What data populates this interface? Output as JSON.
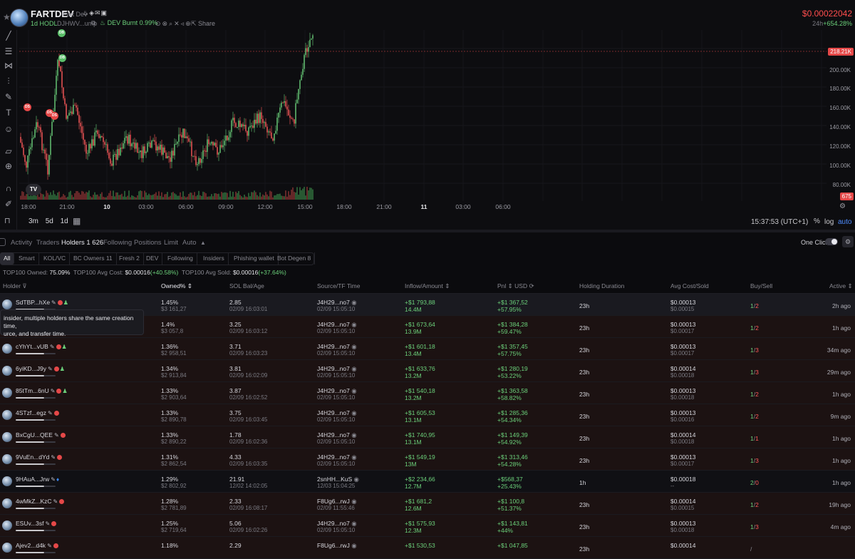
{
  "header": {
    "token_name": "FARTDEV",
    "token_sub": "Fart Dev",
    "hodl": "1d HODL",
    "address": "DJHWV...ump",
    "dev_burnt": "DEV Burnt 0.99%",
    "share": "Share",
    "price": "$0.00022042",
    "change_label": "24h",
    "change_value": "+654.28%"
  },
  "chart": {
    "y_ticks": [
      "200.00K",
      "180.00K",
      "160.00K",
      "140.00K",
      "120.00K",
      "100.00K",
      "80.00K"
    ],
    "current_label": "218.21K",
    "volume_label": "675",
    "x_ticks": [
      "18:00",
      "21:00",
      "10",
      "03:00",
      "06:00",
      "09:00",
      "12:00",
      "15:00",
      "18:00",
      "21:00",
      "11",
      "03:00",
      "06:00"
    ],
    "markers": [
      "DS",
      "DS",
      "DS",
      "DB",
      "DB"
    ],
    "timeframes": [
      "3m",
      "5d",
      "1d"
    ],
    "time_utc": "15:37:53 (UTC+1)",
    "pct": "%",
    "log": "log",
    "auto": "auto",
    "tv_logo": "TV"
  },
  "tabs": {
    "items": [
      "Activity",
      "Traders",
      "Holders 1 626",
      "Following",
      "Positions",
      "Limit",
      "Auto"
    ],
    "active": "Holders 1 626",
    "one_click": "One Click"
  },
  "filters": [
    "All",
    "Smart",
    "KOL/VC",
    "BC Owners 11",
    "Fresh 2",
    "DEV",
    "Following",
    "Insiders",
    "Phishing wallet",
    "Bot Degen 8"
  ],
  "summary": {
    "owned_label": "TOP100 Owned:",
    "owned_value": "75.09%",
    "avg_cost_label": "TOP100 Avg Cost:",
    "avg_cost_value": "$0.00016",
    "avg_cost_change": "(+40.58%)",
    "avg_sold_label": "TOP100 Avg Sold:",
    "avg_sold_value": "$0.00016",
    "avg_sold_change": "(+37.64%)"
  },
  "columns": [
    "Holder",
    "Owned%",
    "SOL Bal/Age",
    "Source/TF Time",
    "Inflow/Amount",
    "Pnl",
    "USD",
    "Holding Duration",
    "Avg Cost/Sold",
    "Buy/Sell",
    "Active"
  ],
  "tooltip": {
    "line1": "insider, multiple holders share the same creation time,",
    "line2": "urce, and transfer time."
  },
  "rows": [
    {
      "holder": "SdTBP...hXe",
      "owned": "1.45%",
      "owned_usd": "$3 161,27",
      "sol": "2.85",
      "age": "02/09 16:03:01",
      "src": "J4H29...no7",
      "tf": "02/09 15:05:10",
      "inflow": "+$1 793,88",
      "amount": "14.4M",
      "pnl": "+$1 367,52",
      "pnl_pct": "+57.95%",
      "dur": "23h",
      "avg_cost": "$0.00013",
      "avg_sold": "$0.00015",
      "buy": "1",
      "sell": "2",
      "active": "2h ago"
    },
    {
      "holder": "",
      "owned": "1.4%",
      "owned_usd": "$3 057,8",
      "sol": "3.25",
      "age": "02/09 16:03:12",
      "src": "J4H29...no7",
      "tf": "02/09 15:05:10",
      "inflow": "+$1 673,64",
      "amount": "13.9M",
      "pnl": "+$1 384,28",
      "pnl_pct": "+59.47%",
      "dur": "23h",
      "avg_cost": "$0.00013",
      "avg_sold": "$0.00017",
      "buy": "1",
      "sell": "2",
      "active": "1h ago"
    },
    {
      "holder": "cYhYt...vUB",
      "owned": "1.36%",
      "owned_usd": "$2 958,51",
      "sol": "3.71",
      "age": "02/09 16:03:23",
      "src": "J4H29...no7",
      "tf": "02/09 15:05:10",
      "inflow": "+$1 601,18",
      "amount": "13.4M",
      "pnl": "+$1 357,45",
      "pnl_pct": "+57.75%",
      "dur": "23h",
      "avg_cost": "$0.00013",
      "avg_sold": "$0.00017",
      "buy": "1",
      "sell": "3",
      "active": "34m ago"
    },
    {
      "holder": "6yiKD...J9y",
      "owned": "1.34%",
      "owned_usd": "$2 913,84",
      "sol": "3.81",
      "age": "02/09 16:02:09",
      "src": "J4H29...no7",
      "tf": "02/09 15:05:10",
      "inflow": "+$1 633,76",
      "amount": "13.2M",
      "pnl": "+$1 280,19",
      "pnl_pct": "+53.22%",
      "dur": "23h",
      "avg_cost": "$0.00014",
      "avg_sold": "$0.00018",
      "buy": "1",
      "sell": "3",
      "active": "29m ago"
    },
    {
      "holder": "85tTm...6nU",
      "owned": "1.33%",
      "owned_usd": "$2 903,64",
      "sol": "3.87",
      "age": "02/09 16:02:52",
      "src": "J4H29...no7",
      "tf": "02/09 15:05:10",
      "inflow": "+$1 540,18",
      "amount": "13.2M",
      "pnl": "+$1 363,58",
      "pnl_pct": "+58.82%",
      "dur": "23h",
      "avg_cost": "$0.00013",
      "avg_sold": "$0.00018",
      "buy": "1",
      "sell": "2",
      "active": "1h ago"
    },
    {
      "holder": "4STzf...egz",
      "owned": "1.33%",
      "owned_usd": "$2 890,78",
      "sol": "3.75",
      "age": "02/09 16:03:45",
      "src": "J4H29...no7",
      "tf": "02/09 15:05:10",
      "inflow": "+$1 605,53",
      "amount": "13.1M",
      "pnl": "+$1 285,36",
      "pnl_pct": "+54.34%",
      "dur": "23h",
      "avg_cost": "$0.00013",
      "avg_sold": "$0.00016",
      "buy": "1",
      "sell": "2",
      "active": "9m ago"
    },
    {
      "holder": "BxCgU...QEE",
      "owned": "1.33%",
      "owned_usd": "$2 890,22",
      "sol": "1.78",
      "age": "02/09 16:02:36",
      "src": "J4H29...no7",
      "tf": "02/09 15:05:10",
      "inflow": "+$1 740,95",
      "amount": "13.1M",
      "pnl": "+$1 149,39",
      "pnl_pct": "+54.92%",
      "dur": "23h",
      "avg_cost": "$0.00014",
      "avg_sold": "$0.00018",
      "buy": "1",
      "sell": "1",
      "active": "1h ago"
    },
    {
      "holder": "9VuEn...dYd",
      "owned": "1.31%",
      "owned_usd": "$2 862,54",
      "sol": "4.33",
      "age": "02/09 16:03:35",
      "src": "J4H29...no7",
      "tf": "02/09 15:05:10",
      "inflow": "+$1 549,19",
      "amount": "13M",
      "pnl": "+$1 313,46",
      "pnl_pct": "+54.28%",
      "dur": "23h",
      "avg_cost": "$0.00013",
      "avg_sold": "$0.00017",
      "buy": "1",
      "sell": "3",
      "active": "1h ago"
    },
    {
      "holder": "9HAuA...Jrw",
      "owned": "1.29%",
      "owned_usd": "$2 802,92",
      "sol": "21.91",
      "age": "12/02 14:02:05",
      "src": "2snHH...KuS",
      "tf": "12/03 15:04:25",
      "inflow": "+$2 234,66",
      "amount": "12.7M",
      "pnl": "+$568,37",
      "pnl_pct": "+25.43%",
      "dur": "1h",
      "avg_cost": "$0.00018",
      "avg_sold": "--",
      "buy": "2",
      "sell": "0",
      "active": "1h ago"
    },
    {
      "holder": "4wMkZ...KzC",
      "owned": "1.28%",
      "owned_usd": "$2 781,89",
      "sol": "2.33",
      "age": "02/09 16:08:17",
      "src": "F8Ug6...rwJ",
      "tf": "02/09 11:55:46",
      "inflow": "+$1 681,2",
      "amount": "12.6M",
      "pnl": "+$1 100,8",
      "pnl_pct": "+51.37%",
      "dur": "23h",
      "avg_cost": "$0.00014",
      "avg_sold": "$0.00015",
      "buy": "1",
      "sell": "2",
      "active": "19h ago"
    },
    {
      "holder": "ESUv...3sf",
      "owned": "1.25%",
      "owned_usd": "$2 719,64",
      "sol": "5.06",
      "age": "02/09 16:02:26",
      "src": "J4H29...no7",
      "tf": "02/09 15:05:10",
      "inflow": "+$1 575,93",
      "amount": "12.3M",
      "pnl": "+$1 143,81",
      "pnl_pct": "+44%",
      "dur": "23h",
      "avg_cost": "$0.00013",
      "avg_sold": "$0.00018",
      "buy": "1",
      "sell": "3",
      "active": "4m ago"
    },
    {
      "holder": "Ajev2...d4k",
      "owned": "1.18%",
      "owned_usd": "",
      "sol": "2.29",
      "age": "",
      "src": "F8Ug6...rwJ",
      "tf": "",
      "inflow": "+$1 530,53",
      "amount": "",
      "pnl": "+$1 047,85",
      "pnl_pct": "",
      "dur": "23h",
      "avg_cost": "$0.00014",
      "avg_sold": "",
      "buy": "",
      "sell": "",
      "active": ""
    }
  ]
}
